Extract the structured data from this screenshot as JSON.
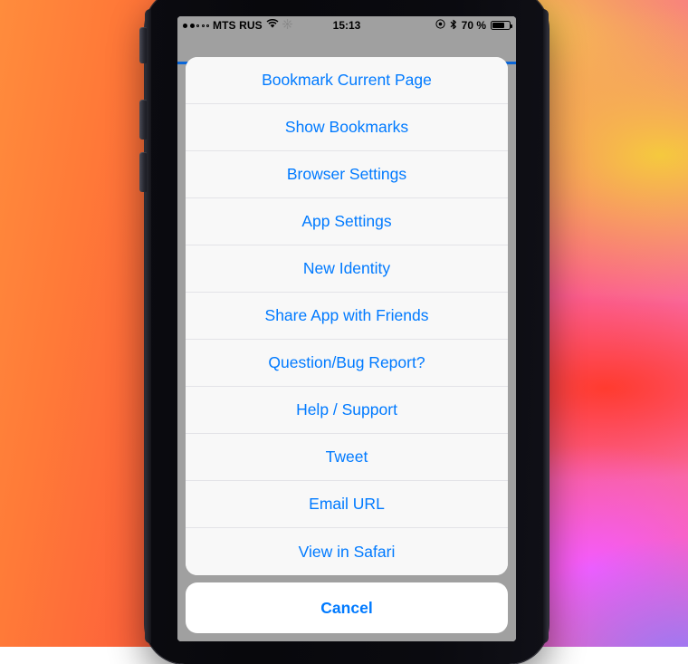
{
  "status_bar": {
    "signal_dots_total": 5,
    "signal_dots_filled": 2,
    "carrier": "MTS RUS",
    "wifi_icon": "wifi-icon",
    "activity_icon": "network-activity-icon",
    "clock": "15:13",
    "location_icon": "location-services-icon",
    "bluetooth_icon": "bluetooth-icon",
    "battery_percent": "70 %",
    "battery_level": 70
  },
  "action_sheet": {
    "items": [
      {
        "label": "Bookmark Current Page",
        "name": "sheet-item-bookmark-current-page"
      },
      {
        "label": "Show Bookmarks",
        "name": "sheet-item-show-bookmarks"
      },
      {
        "label": "Browser Settings",
        "name": "sheet-item-browser-settings"
      },
      {
        "label": "App Settings",
        "name": "sheet-item-app-settings"
      },
      {
        "label": "New Identity",
        "name": "sheet-item-new-identity"
      },
      {
        "label": "Share App with Friends",
        "name": "sheet-item-share-app-with-friends"
      },
      {
        "label": "Question/Bug Report?",
        "name": "sheet-item-question-bug-report"
      },
      {
        "label": "Help / Support",
        "name": "sheet-item-help-support"
      },
      {
        "label": "Tweet",
        "name": "sheet-item-tweet"
      },
      {
        "label": "Email URL",
        "name": "sheet-item-email-url"
      },
      {
        "label": "View in Safari",
        "name": "sheet-item-view-in-safari"
      }
    ],
    "cancel_label": "Cancel"
  },
  "colors": {
    "tint_blue": "#007AFF",
    "sheet_background": "#f8f8f8",
    "cancel_background": "#ffffff",
    "separator": "#e3e3e7",
    "dimmed_page": "#a0a0a0",
    "progress_blue": "#0a66d8"
  }
}
